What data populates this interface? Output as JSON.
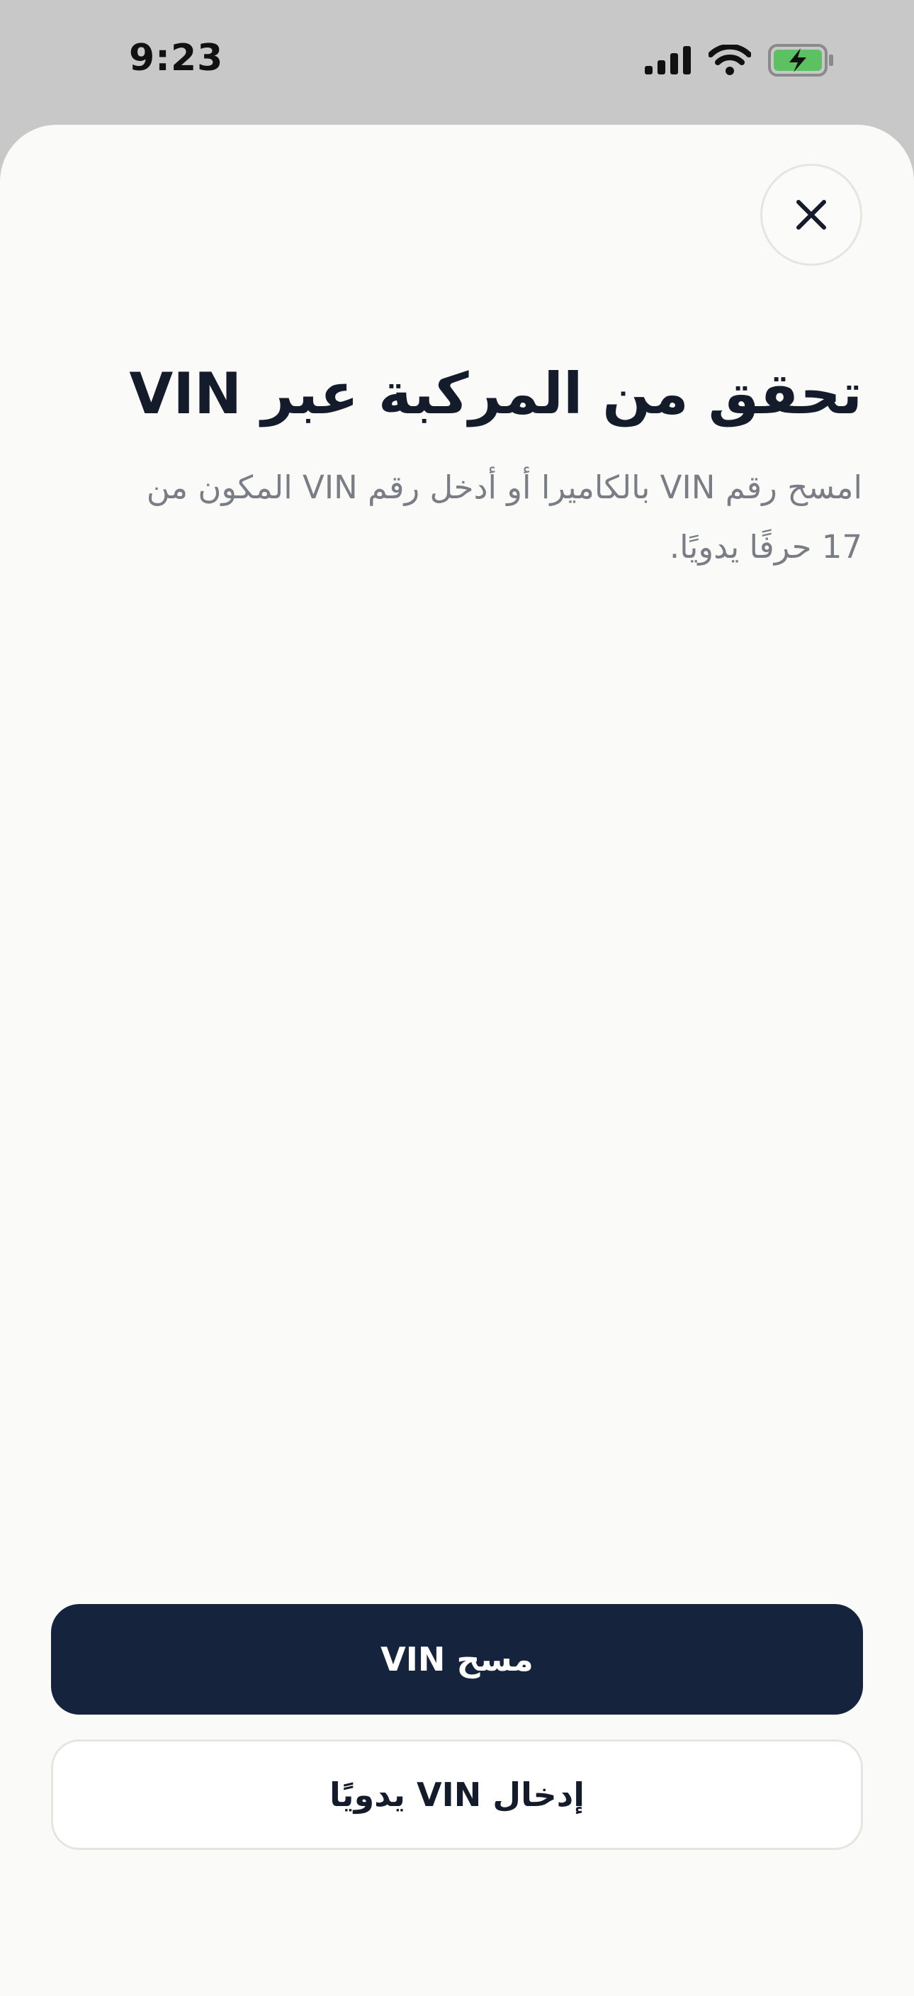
{
  "status_bar": {
    "time": "9:23",
    "icons": [
      "signal-icon",
      "wifi-icon",
      "battery-charging-icon"
    ],
    "battery_color": "#5cc160"
  },
  "sheet": {
    "close_icon": "close-icon",
    "title": "تحقق من المركبة عبر VIN",
    "subtitle": "امسح رقم VIN بالكاميرا أو أدخل رقم VIN المكون من 17 حرفًا يدويًا."
  },
  "actions": {
    "scan_label": "مسح VIN",
    "manual_label": "إدخال VIN يدويًا"
  },
  "colors": {
    "primary": "#15233d",
    "text_dark": "#141c2c",
    "text_muted": "#7a7d85",
    "sheet_bg": "#fafaf8",
    "backdrop": "#c8c8c8"
  }
}
